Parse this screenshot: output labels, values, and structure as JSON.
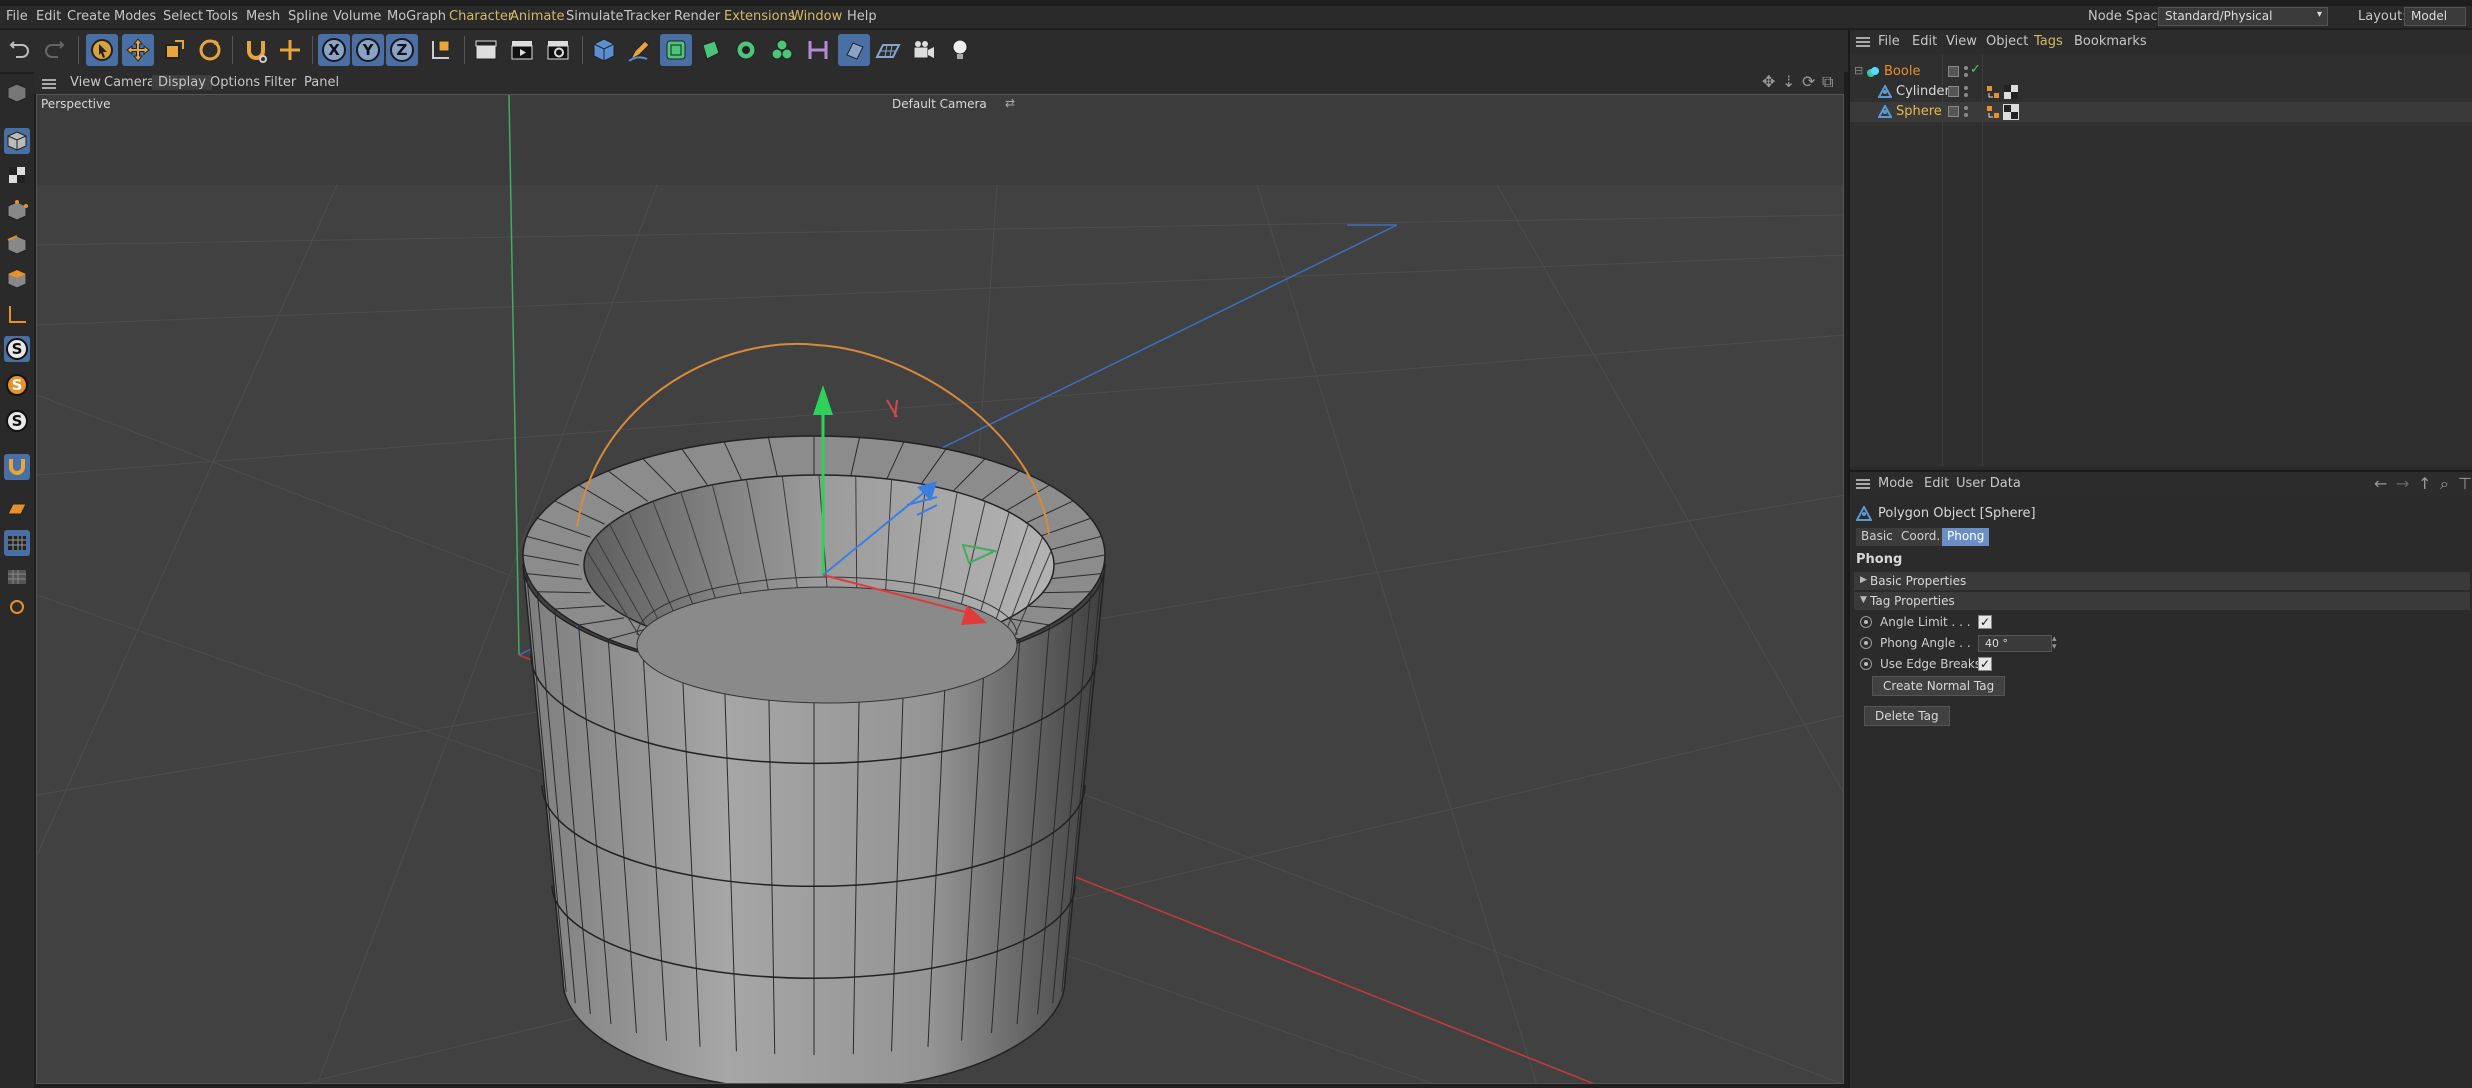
{
  "menubar": {
    "items": [
      "File",
      "Edit",
      "Create",
      "Modes",
      "Select",
      "Tools",
      "Mesh",
      "Spline",
      "Volume",
      "MoGraph",
      "Character",
      "Animate",
      "Simulate",
      "Tracker",
      "Render",
      "Extensions",
      "Window",
      "Help"
    ],
    "node_space_label": "Node Space:",
    "node_space_value": "Standard/Physical",
    "layout_label": "Layout:",
    "layout_value": "Model"
  },
  "viewport": {
    "menu": [
      "View",
      "Cameras",
      "Display",
      "Options",
      "Filter",
      "Panel"
    ],
    "active_menu": "Display",
    "view_name": "Perspective",
    "camera_name": "Default Camera"
  },
  "object_manager": {
    "menu": [
      "File",
      "Edit",
      "View",
      "Object",
      "Tags",
      "Bookmarks"
    ],
    "objects": [
      {
        "name": "Boole",
        "level": 0
      },
      {
        "name": "Cylinder",
        "level": 1
      },
      {
        "name": "Sphere",
        "level": 1
      }
    ]
  },
  "attribute_manager": {
    "menu": [
      "Mode",
      "Edit",
      "User Data"
    ],
    "object_title": "Polygon Object [Sphere]",
    "tabs": [
      "Basic",
      "Coord.",
      "Phong"
    ],
    "active_tab": "Phong",
    "section_title": "Phong",
    "groups": {
      "basic": "Basic Properties",
      "tag": "Tag Properties"
    },
    "params": {
      "angle_limit_label": "Angle Limit . . .",
      "angle_limit_checked": true,
      "phong_angle_label": "Phong Angle . .",
      "phong_angle_value": "40 °",
      "edge_breaks_label": "Use Edge Breaks",
      "edge_breaks_checked": true
    },
    "create_normal_tag": "Create Normal Tag",
    "delete_tag": "Delete Tag"
  },
  "colors": {
    "accent_blue": "#4a6fa5",
    "selected_orange": "#e8902a",
    "menu_highlight": "#d3b86a",
    "viewport_bg": "#3f3f3f"
  },
  "icons": {
    "undo": "undo-icon",
    "redo": "redo-icon",
    "move": "move-icon",
    "scale": "scale-icon",
    "rotate": "rotate-icon",
    "cube": "cube-icon",
    "pen": "pen-icon",
    "light": "light-bulb-icon"
  }
}
